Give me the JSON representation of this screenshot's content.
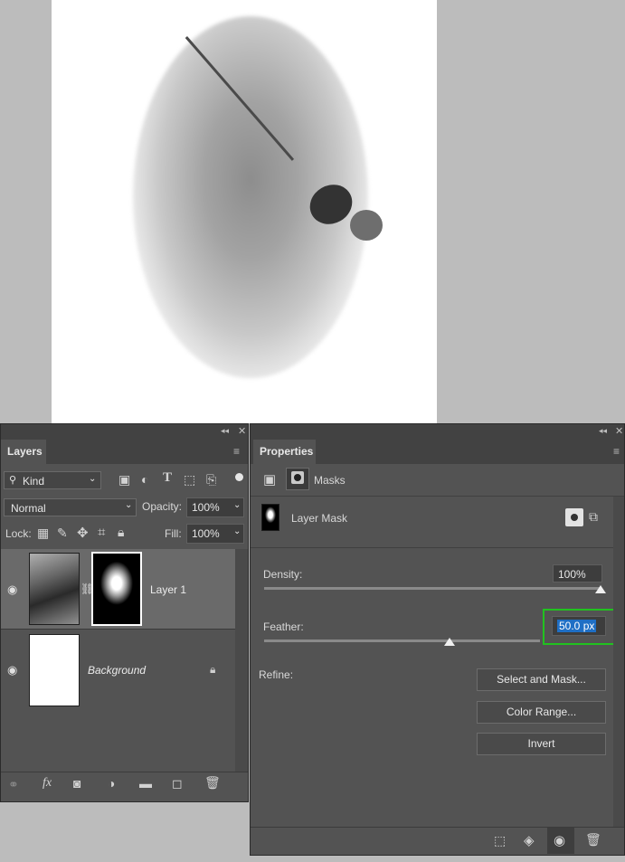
{
  "canvas": {
    "image_desc_icon": "photo-canvas"
  },
  "layers_panel": {
    "tab_label": "Layers",
    "kind_filter": "Kind",
    "blend_mode": "Normal",
    "opacity_label": "Opacity:",
    "opacity_value": "100%",
    "lock_label": "Lock:",
    "fill_label": "Fill:",
    "fill_value": "100%",
    "layers": [
      {
        "name": "Layer 1"
      },
      {
        "name": "Background"
      }
    ]
  },
  "properties_panel": {
    "tab_label": "Properties",
    "section_label": "Masks",
    "mask_name": "Layer Mask",
    "density_label": "Density:",
    "density_value": "100%",
    "density_level": 1.0,
    "feather_label": "Feather:",
    "feather_value": "50.0 px",
    "feather_level": 0.55,
    "refine_label": "Refine:",
    "buttons": {
      "select_and_mask": "Select and Mask...",
      "color_range": "Color Range...",
      "invert": "Invert"
    }
  },
  "colors": {
    "panel_bg": "#535353",
    "tabbar_bg": "#424242",
    "highlight_box": "#21c21f",
    "selection_text_bg": "#1f6fc5"
  }
}
